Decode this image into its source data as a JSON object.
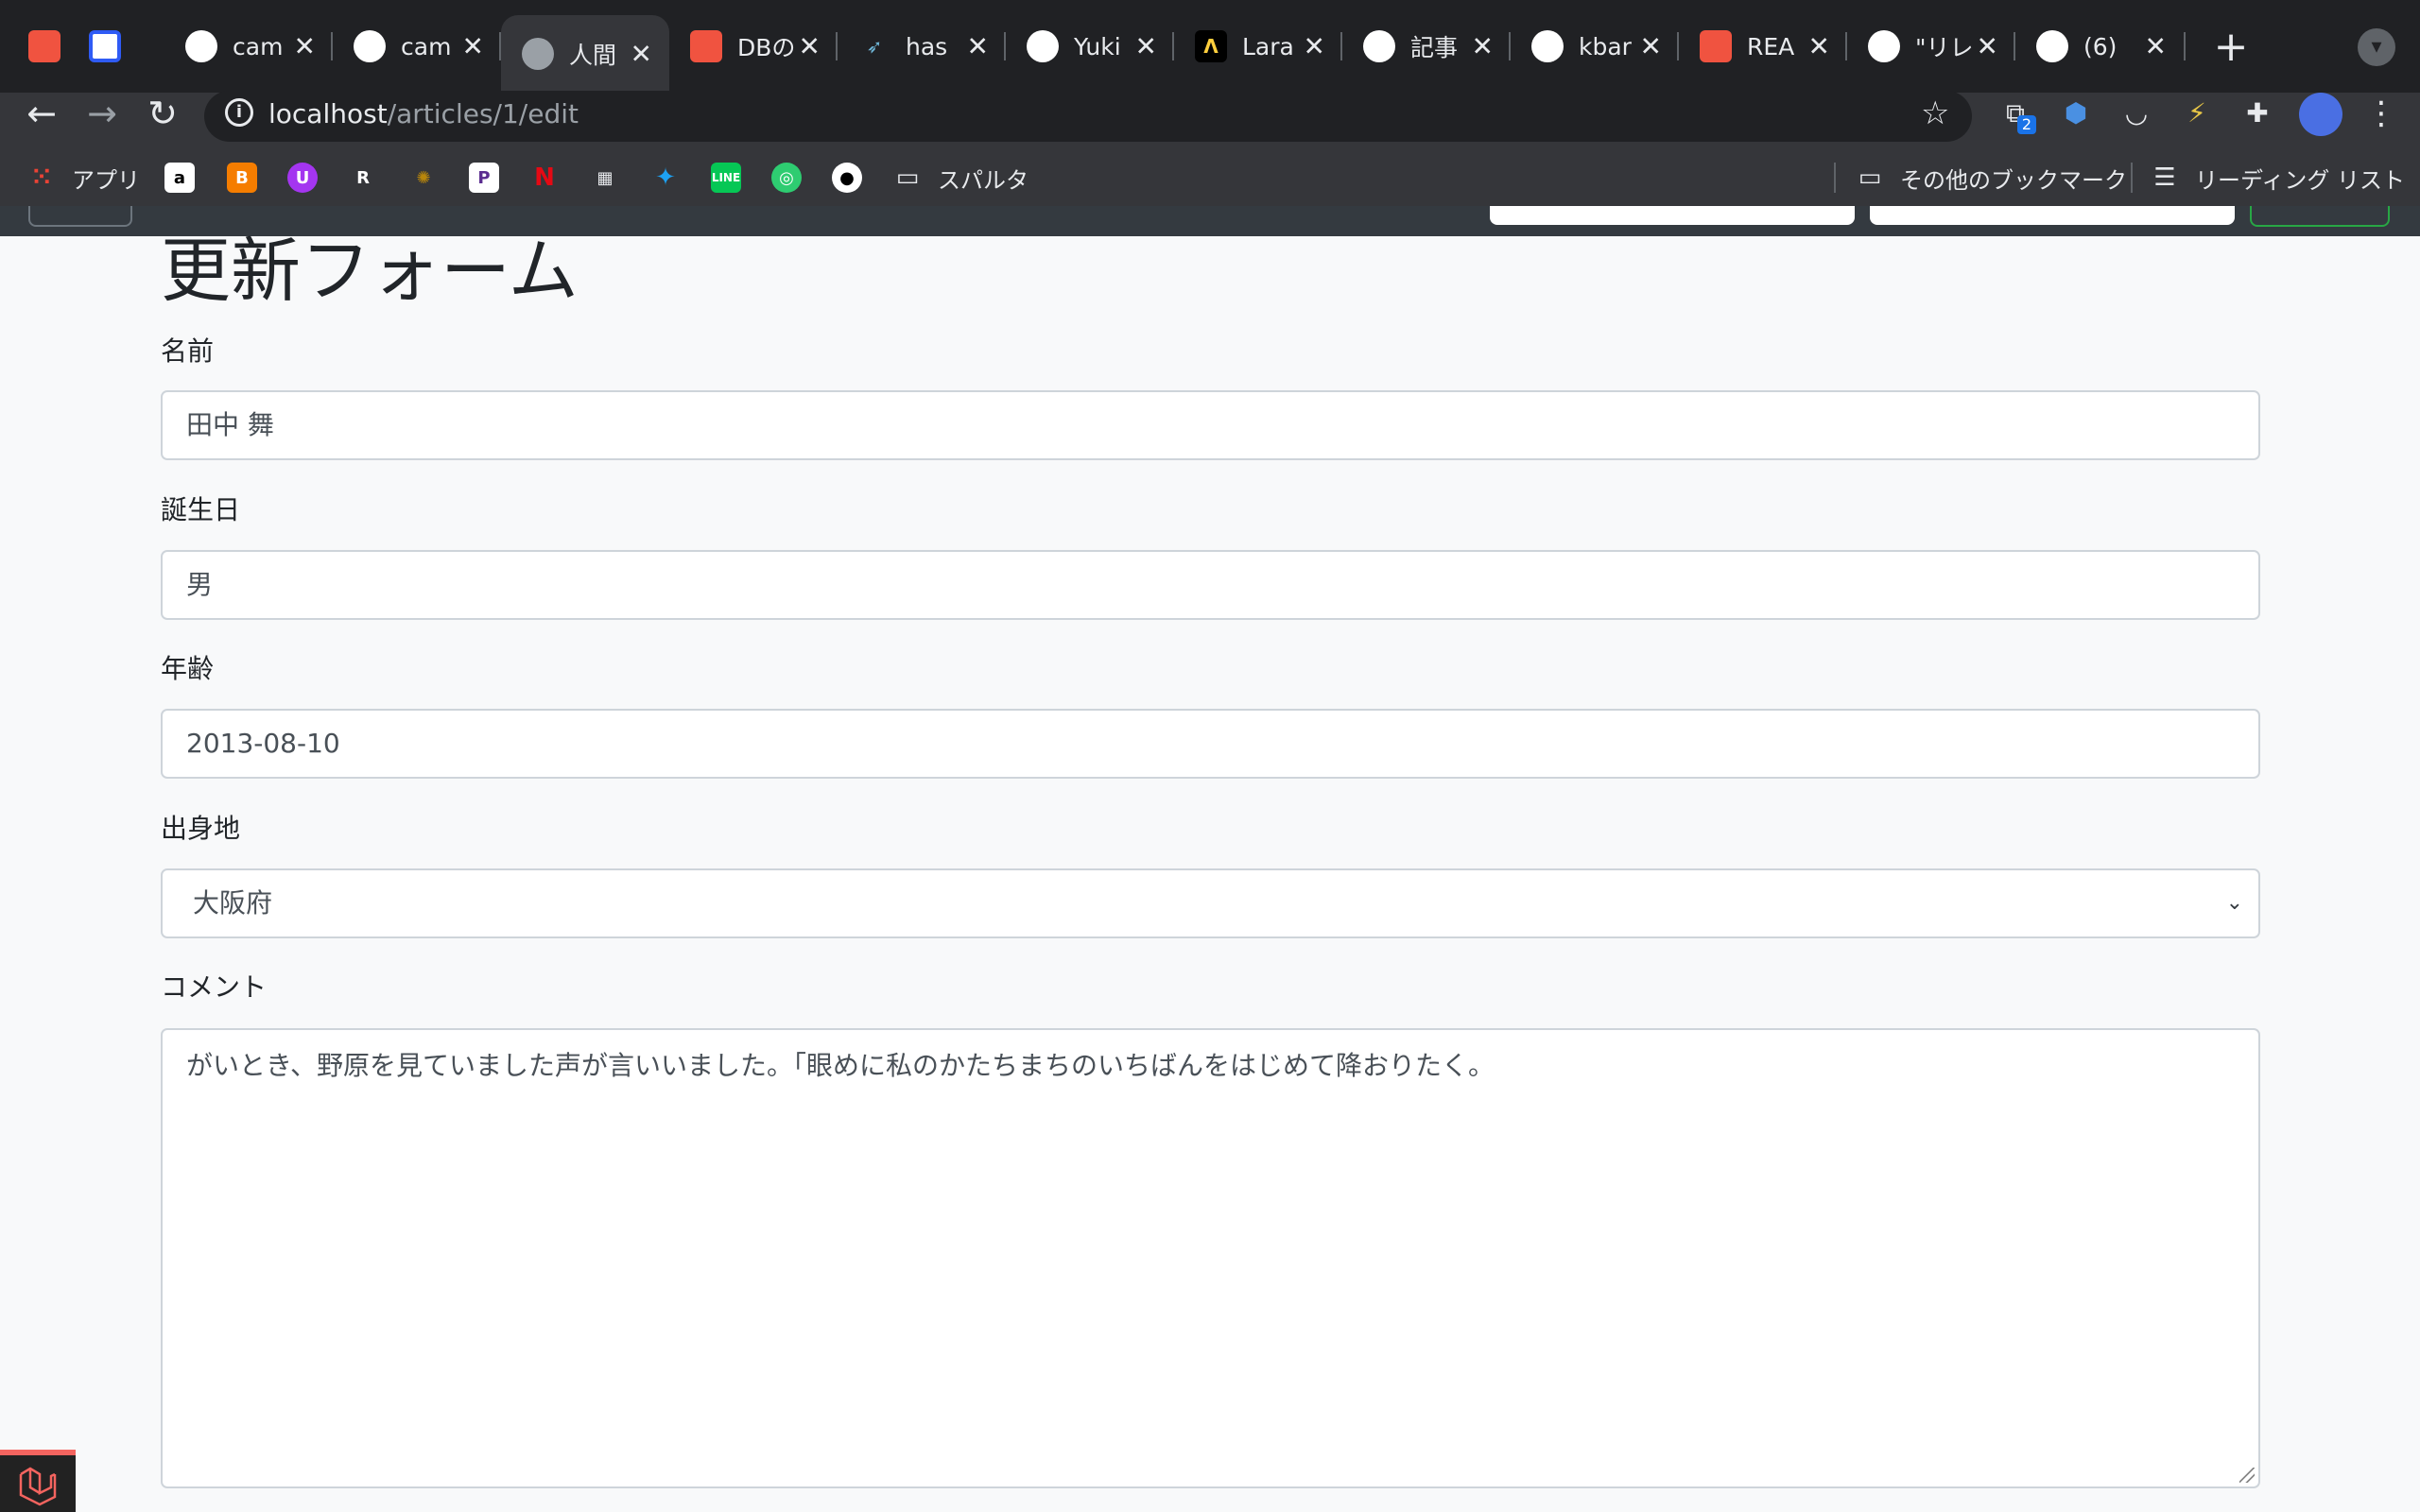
{
  "browser": {
    "tabs": [
      {
        "title": "",
        "icon": "laravel-icon",
        "color": "#f05340"
      },
      {
        "title": "",
        "icon": "bookmark-app-icon",
        "color": "#2f5bf5"
      },
      {
        "title": "cam",
        "icon": "github-icon",
        "color": "#ffffff"
      },
      {
        "title": "cam",
        "icon": "github-icon",
        "color": "#ffffff"
      },
      {
        "title": "人間",
        "icon": "globe-icon",
        "color": "#9aa0a6"
      },
      {
        "title": "DBの",
        "icon": "laravel-icon",
        "color": "#f05340"
      },
      {
        "title": "has",
        "icon": "hummingbird-icon",
        "color": "#6fb7d8"
      },
      {
        "title": "Yuki",
        "icon": "github-icon",
        "color": "#ffffff"
      },
      {
        "title": "Lara",
        "icon": "laracasts-icon",
        "color": "#ffcf3d"
      },
      {
        "title": "記事",
        "icon": "github-icon",
        "color": "#ffffff"
      },
      {
        "title": "kbar",
        "icon": "github-icon",
        "color": "#ffffff"
      },
      {
        "title": "REA",
        "icon": "laravel-icon",
        "color": "#f05340"
      },
      {
        "title": "\"リレ",
        "icon": "github-icon",
        "color": "#ffffff"
      },
      {
        "title": "(6)",
        "icon": "github-icon",
        "color": "#ffffff"
      }
    ],
    "url_host": "localhost",
    "url_path": "/articles/1/edit",
    "extension_badge": "2",
    "bookmarks": {
      "apps_label": "アプリ",
      "folder_label": "スパルタ",
      "other_bookmarks_label": "その他のブックマーク",
      "reading_list_label": "リーディング リスト"
    }
  },
  "form": {
    "title": "更新フォーム",
    "name_label": "名前",
    "name_value": "田中 舞",
    "birthday_label": "誕生日",
    "birthday_value": "男",
    "age_label": "年齢",
    "age_value": "2013-08-10",
    "hometown_label": "出身地",
    "hometown_value": "大阪府",
    "comment_label": "コメント",
    "comment_value": "がいとき、野原を見ていました声が言いいました。「眼めに私のかたちまちのいちばんをはじめて降おりたく。"
  },
  "colors": {
    "accent_danger": "#f4645f",
    "accent_success": "#28a745",
    "navbar": "#343a40"
  }
}
